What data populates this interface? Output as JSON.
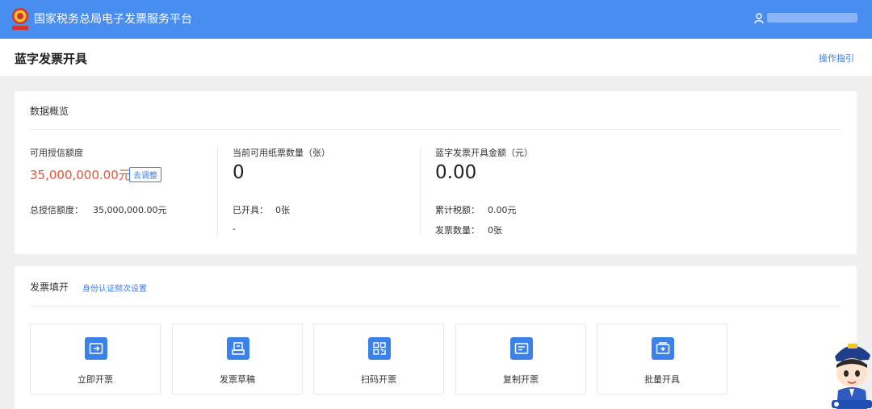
{
  "header": {
    "app_title": "国家税务总局电子发票服务平台",
    "user_icon": "user-icon"
  },
  "page": {
    "title": "蓝字发票开具",
    "guide_link": "操作指引"
  },
  "overview": {
    "title": "数据概览",
    "credit": {
      "label": "可用授信额度",
      "value": "35,000,000.00元",
      "adjust_button": "去调整",
      "total_label": "总授信额度：",
      "total_value": "35,000,000.00元"
    },
    "paper": {
      "label": "当前可用纸票数量（张）",
      "value": "0",
      "issued_label": "已开具：",
      "issued_value": "0张",
      "extra": "-"
    },
    "amount": {
      "label": "蓝字发票开具金额（元）",
      "value": "0.00",
      "tax_label": "累计税额：",
      "tax_value": "0.00元",
      "count_label": "发票数量：",
      "count_value": "0张"
    }
  },
  "fill": {
    "title": "发票填开",
    "auth_link": "身份认证频次设置",
    "tiles": [
      {
        "label": "立即开票",
        "icon": "invoice-now-icon"
      },
      {
        "label": "发票草稿",
        "icon": "draft-icon"
      },
      {
        "label": "扫码开票",
        "icon": "qr-code-icon"
      },
      {
        "label": "复制开票",
        "icon": "copy-invoice-icon"
      },
      {
        "label": "批量开具",
        "icon": "batch-invoice-icon"
      }
    ]
  },
  "colors": {
    "header_bg": "#4a8df0",
    "accent": "#3a7bea",
    "amount_red": "#e8543a",
    "tile_icon_bg": "#3a82ea"
  }
}
